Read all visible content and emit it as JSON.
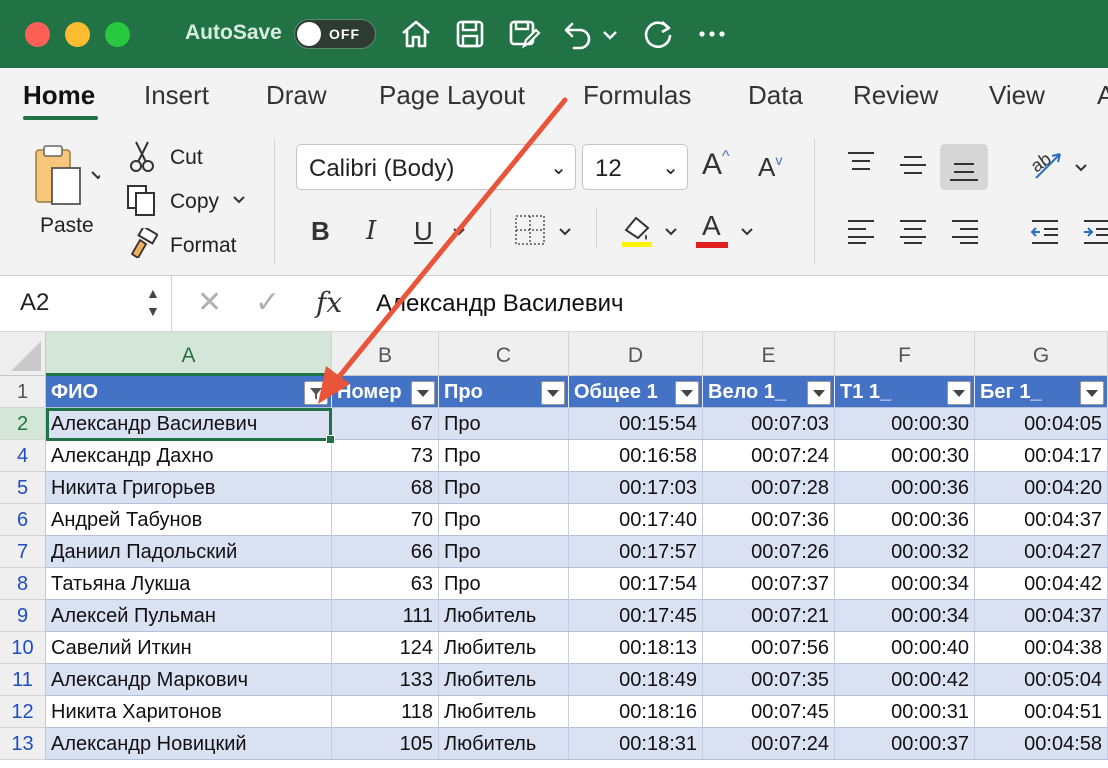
{
  "titlebar": {
    "autosave_label": "AutoSave",
    "autosave_state": "OFF"
  },
  "tabs": [
    "Home",
    "Insert",
    "Draw",
    "Page Layout",
    "Formulas",
    "Data",
    "Review",
    "View",
    "A"
  ],
  "ribbon": {
    "paste": "Paste",
    "cut": "Cut",
    "copy": "Copy",
    "format": "Format",
    "font_name": "Calibri (Body)",
    "font_size": "12",
    "bold": "B",
    "italic": "I",
    "underline": "U",
    "font_color_letter": "A",
    "grow_font": "A",
    "shrink_font": "A"
  },
  "formula_bar": {
    "name_box": "A2",
    "fx": "fx",
    "value": "Александр Василевич"
  },
  "sheet": {
    "columns": [
      "A",
      "B",
      "C",
      "D",
      "E",
      "F",
      "G"
    ],
    "header_row_number": "1",
    "headers": [
      "ФИО",
      "Номер",
      "Про",
      "Общее 1",
      "Вело 1_",
      "T1 1_",
      "Бег 1_"
    ],
    "rows": [
      {
        "n": "2",
        "name": "Александр Василевич",
        "num": "67",
        "cat": "Про",
        "total": "00:15:54",
        "bike": "00:07:03",
        "t1": "00:00:30",
        "run": "00:04:05"
      },
      {
        "n": "4",
        "name": "Александр Дахно",
        "num": "73",
        "cat": "Про",
        "total": "00:16:58",
        "bike": "00:07:24",
        "t1": "00:00:30",
        "run": "00:04:17"
      },
      {
        "n": "5",
        "name": "Никита Григорьев",
        "num": "68",
        "cat": "Про",
        "total": "00:17:03",
        "bike": "00:07:28",
        "t1": "00:00:36",
        "run": "00:04:20"
      },
      {
        "n": "6",
        "name": "Андрей Табунов",
        "num": "70",
        "cat": "Про",
        "total": "00:17:40",
        "bike": "00:07:36",
        "t1": "00:00:36",
        "run": "00:04:37"
      },
      {
        "n": "7",
        "name": "Даниил Падольский",
        "num": "66",
        "cat": "Про",
        "total": "00:17:57",
        "bike": "00:07:26",
        "t1": "00:00:32",
        "run": "00:04:27"
      },
      {
        "n": "8",
        "name": "Татьяна Лукша",
        "num": "63",
        "cat": "Про",
        "total": "00:17:54",
        "bike": "00:07:37",
        "t1": "00:00:34",
        "run": "00:04:42"
      },
      {
        "n": "9",
        "name": "Алексей Пульман",
        "num": "111",
        "cat": "Любитель",
        "total": "00:17:45",
        "bike": "00:07:21",
        "t1": "00:00:34",
        "run": "00:04:37"
      },
      {
        "n": "10",
        "name": "Савелий Иткин",
        "num": "124",
        "cat": "Любитель",
        "total": "00:18:13",
        "bike": "00:07:56",
        "t1": "00:00:40",
        "run": "00:04:38"
      },
      {
        "n": "11",
        "name": "Александр Маркович",
        "num": "133",
        "cat": "Любитель",
        "total": "00:18:49",
        "bike": "00:07:35",
        "t1": "00:00:42",
        "run": "00:05:04"
      },
      {
        "n": "12",
        "name": "Никита Харитонов",
        "num": "118",
        "cat": "Любитель",
        "total": "00:18:16",
        "bike": "00:07:45",
        "t1": "00:00:31",
        "run": "00:04:51"
      },
      {
        "n": "13",
        "name": "Александр Новицкий",
        "num": "105",
        "cat": "Любитель",
        "total": "00:18:31",
        "bike": "00:07:24",
        "t1": "00:00:37",
        "run": "00:04:58"
      }
    ]
  },
  "colors": {
    "excel_green": "#217346",
    "table_header": "#4472c4",
    "table_band": "#d9e1f2",
    "annotation_arrow": "#e8553a"
  }
}
